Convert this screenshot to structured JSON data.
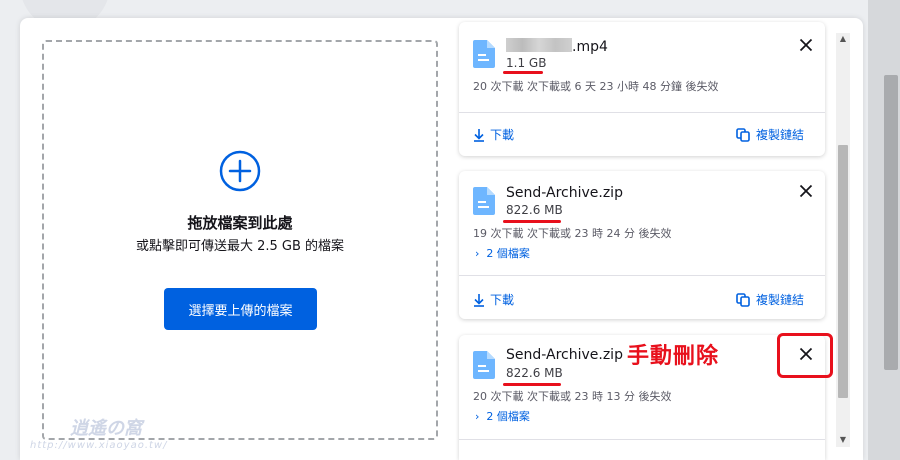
{
  "dropzone": {
    "title": "拖放檔案到此處",
    "subtitle": "或點擊即可傳送最大 2.5 GB 的檔案",
    "button_label": "選擇要上傳的檔案"
  },
  "files": [
    {
      "name_suffix": ".mp4",
      "size": "1.1 GB",
      "meta": "20 次下載 次下載或 6 天 23 小時 48 分鐘 後失效",
      "download_label": "下載",
      "copy_label": "複製鏈結"
    },
    {
      "name": "Send-Archive.zip",
      "size": "822.6 MB",
      "meta": "19 次下載 次下載或 23 時 24 分 後失效",
      "files_label": "2 個檔案",
      "download_label": "下載",
      "copy_label": "複製鏈結"
    },
    {
      "name": "Send-Archive.zip",
      "size": "822.6 MB",
      "meta": "20 次下載 次下載或 23 時 13 分 後失效",
      "files_label": "2 個檔案"
    }
  ],
  "annotation": "手動刪除",
  "watermark": {
    "title": "逍遙の窩",
    "url": "http://www.xiaoyao.tw/"
  },
  "colors": {
    "accent": "#0061e0",
    "annotation": "#e8101c"
  }
}
